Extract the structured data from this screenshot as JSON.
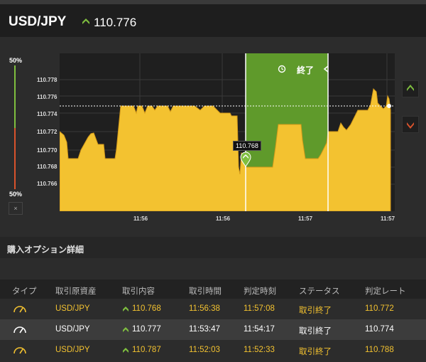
{
  "header": {
    "pair": "USD/JPY",
    "rate": "110.776"
  },
  "meter": {
    "top_pct": "50%",
    "bottom_pct": "50%",
    "close": "×"
  },
  "chart": {
    "zone_label": "終了",
    "marker_label": "110.768",
    "y_ticks": [
      "110.778",
      "110.776",
      "110.774",
      "110.772",
      "110.770",
      "110.768",
      "110.766"
    ],
    "x_ticks": [
      "11:56",
      "11:56",
      "11:57",
      "11:57"
    ]
  },
  "section": {
    "title": "購入オプション詳細"
  },
  "table": {
    "headers": [
      "タイプ",
      "取引原資産",
      "取引内容",
      "取引時間",
      "判定時刻",
      "ステータス",
      "判定レート"
    ],
    "rows": [
      {
        "asset": "USD/JPY",
        "content": "110.768",
        "time": "11:56:38",
        "judge": "11:57:08",
        "status": "取引終了",
        "rate": "110.772"
      },
      {
        "asset": "USD/JPY",
        "content": "110.777",
        "time": "11:53:47",
        "judge": "11:54:17",
        "status": "取引終了",
        "rate": "110.774"
      },
      {
        "asset": "USD/JPY",
        "content": "110.787",
        "time": "11:52:03",
        "judge": "11:52:33",
        "status": "取引終了",
        "rate": "110.788"
      }
    ]
  },
  "colors": {
    "accent_yellow": "#f3c230",
    "up_green": "#7fbf3f",
    "down_red": "#d9532c",
    "zone_green": "#5f9a2b"
  }
}
